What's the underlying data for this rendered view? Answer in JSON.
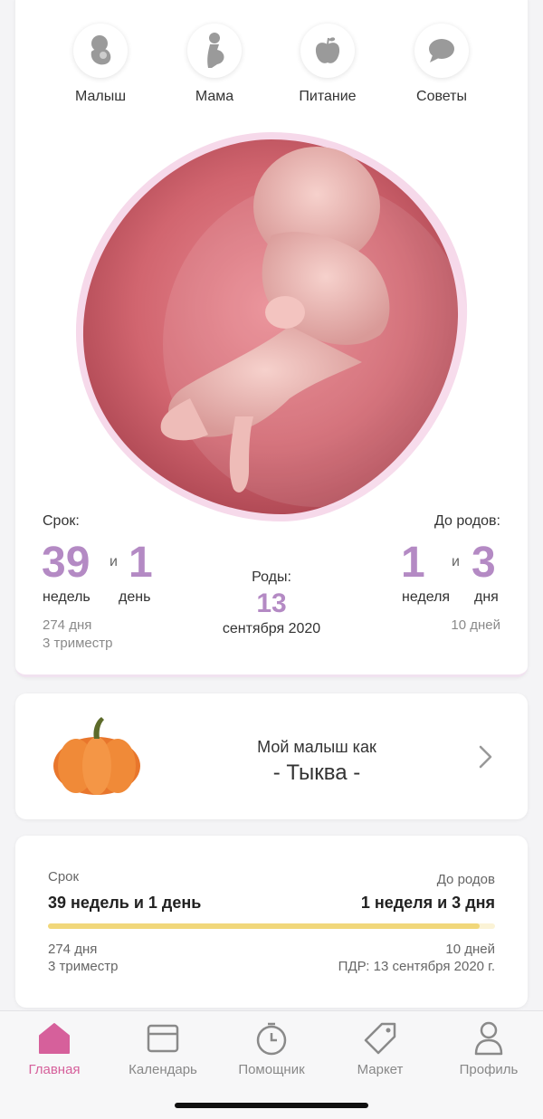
{
  "categories": [
    {
      "label": "Малыш",
      "icon": "baby-icon"
    },
    {
      "label": "Мама",
      "icon": "mother-icon"
    },
    {
      "label": "Питание",
      "icon": "apple-icon"
    },
    {
      "label": "Советы",
      "icon": "chat-bubble-icon"
    }
  ],
  "term": {
    "label": "Срок:",
    "weeks": "39",
    "and": "и",
    "days": "1",
    "weeks_unit": "недель",
    "days_unit": "день",
    "total_days": "274 дня",
    "trimester": "3 триместр"
  },
  "birth": {
    "label": "Роды:",
    "day": "13",
    "month_year": "сентября 2020"
  },
  "until": {
    "label": "До родов:",
    "weeks": "1",
    "and": "и",
    "days": "3",
    "weeks_unit": "неделя",
    "days_unit": "дня",
    "total_days": "10 дней"
  },
  "fruit": {
    "prefix": "Мой малыш как",
    "name": "- Тыква -"
  },
  "progress": {
    "term_label": "Срок",
    "term_value": "39 недель и 1 день",
    "until_label": "До родов",
    "until_value": "1 неделя и 3 дня",
    "total_days": "274 дня",
    "trimester": "3 триместр",
    "remaining_days": "10 дней",
    "due_date": "ПДР: 13 сентября 2020 г.",
    "fraction": 0.965
  },
  "tabs": [
    {
      "label": "Главная",
      "icon": "home-icon",
      "active": true
    },
    {
      "label": "Календарь",
      "icon": "calendar-icon",
      "active": false
    },
    {
      "label": "Помощник",
      "icon": "clock-icon",
      "active": false
    },
    {
      "label": "Маркет",
      "icon": "tag-icon",
      "active": false
    },
    {
      "label": "Профиль",
      "icon": "profile-icon",
      "active": false
    }
  ],
  "colors": {
    "accent": "#b48ac4",
    "active_tab": "#d6609b",
    "progress": "#f1d77a"
  }
}
